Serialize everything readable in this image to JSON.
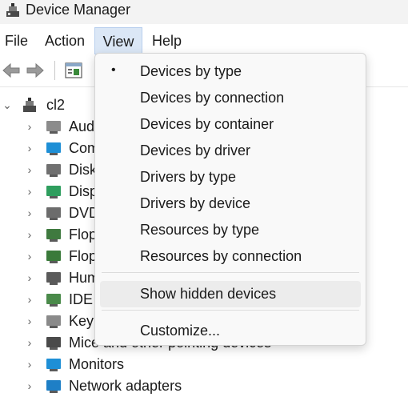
{
  "window": {
    "title": "Device Manager",
    "icon": "device-manager-icon"
  },
  "menubar": {
    "file": "File",
    "action": "Action",
    "view": "View",
    "help": "Help"
  },
  "toolbar": {
    "back": "back-arrow-icon",
    "forward": "forward-arrow-icon",
    "properties": "properties-icon"
  },
  "tree": {
    "root": "cl2",
    "items": [
      {
        "label": "Audio inputs and outputs",
        "icon": "speaker-icon"
      },
      {
        "label": "Computer",
        "icon": "computer-icon"
      },
      {
        "label": "Disk drives",
        "icon": "disk-drive-icon"
      },
      {
        "label": "Display adapters",
        "icon": "display-adapter-icon"
      },
      {
        "label": "DVD/CD-ROM drives",
        "icon": "dvd-drive-icon"
      },
      {
        "label": "Floppy disk controllers",
        "icon": "floppy-controller-icon"
      },
      {
        "label": "Floppy drive controllers",
        "icon": "floppy-drive-icon"
      },
      {
        "label": "Human Interface Devices",
        "icon": "hid-icon"
      },
      {
        "label": "IDE ATA/ATAPI controllers",
        "icon": "ide-controller-icon"
      },
      {
        "label": "Keyboards",
        "icon": "keyboard-icon"
      },
      {
        "label": "Mice and other pointing devices",
        "icon": "mouse-icon"
      },
      {
        "label": "Monitors",
        "icon": "monitor-icon"
      },
      {
        "label": "Network adapters",
        "icon": "network-adapter-icon"
      }
    ]
  },
  "view_menu": {
    "items": [
      {
        "label": "Devices by type",
        "checked": true
      },
      {
        "label": "Devices by connection"
      },
      {
        "label": "Devices by container"
      },
      {
        "label": "Devices by driver"
      },
      {
        "label": "Drivers by type"
      },
      {
        "label": "Drivers by device"
      },
      {
        "label": "Resources by type"
      },
      {
        "label": "Resources by connection"
      }
    ],
    "show_hidden": "Show hidden devices",
    "customize": "Customize...",
    "bullet": "•"
  }
}
